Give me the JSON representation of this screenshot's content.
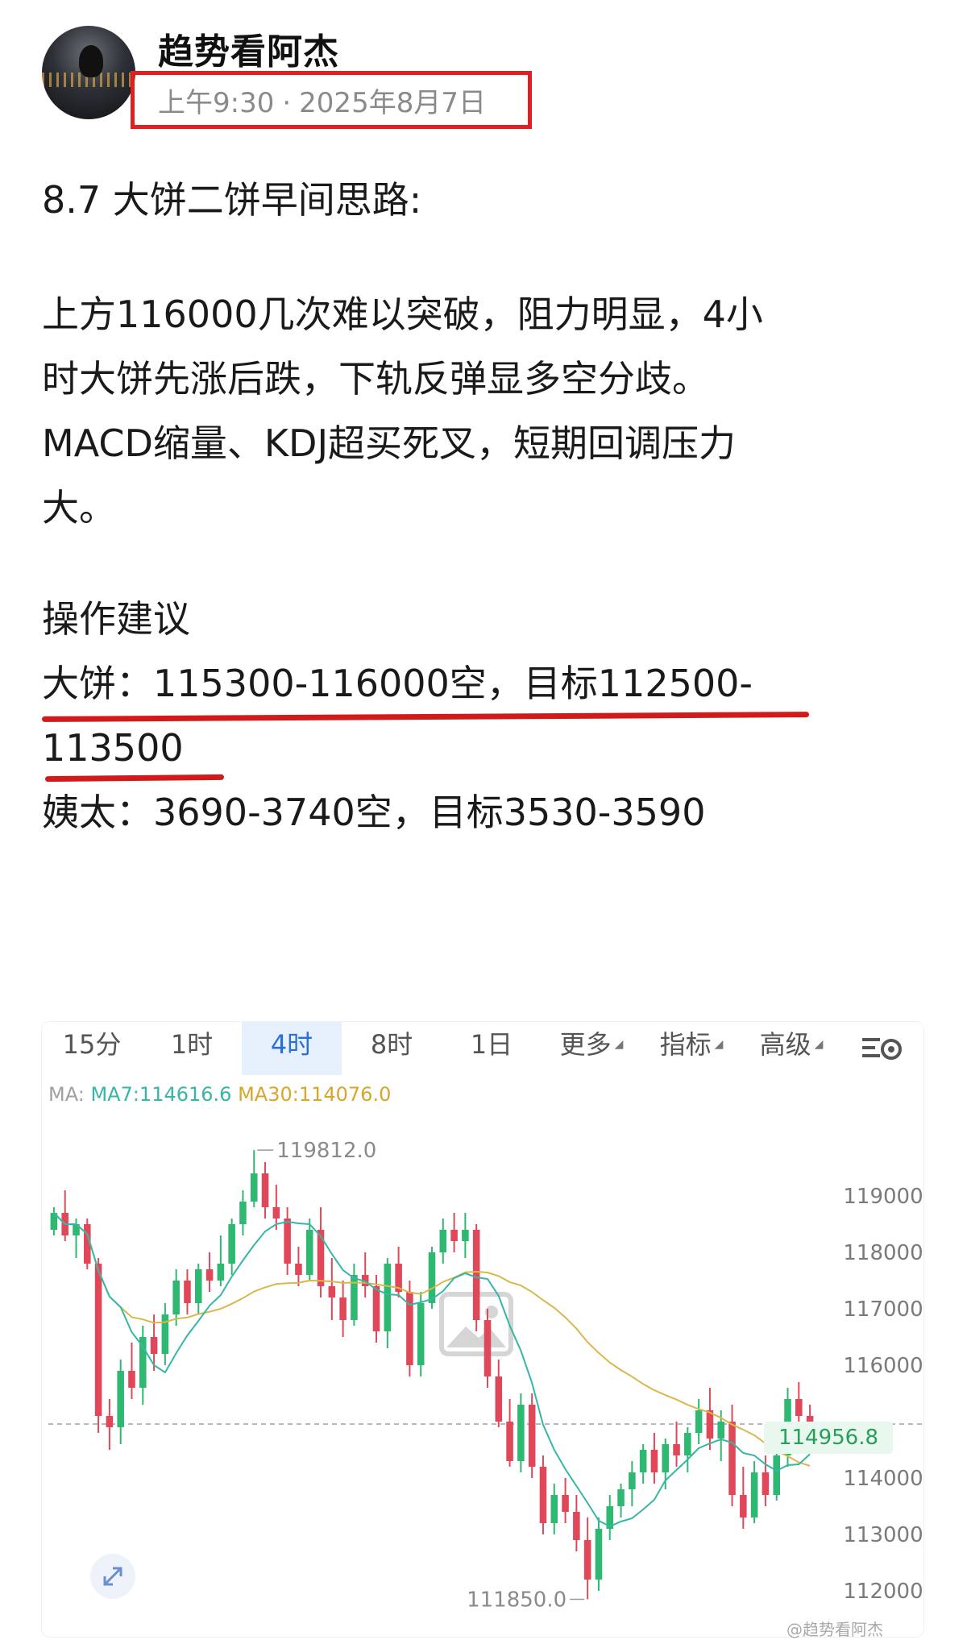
{
  "post": {
    "author": "趋势看阿杰",
    "time": "上午9:30",
    "date": "2025年8月7日",
    "separator": "·",
    "title": "8.7 大饼二饼早间思路:",
    "body_lines": [
      "上方116000几次难以突破，阻力明显，4小",
      "时大饼先涨后跌，下轨反弹显多空分歧。",
      "MACD缩量、KDJ超买死叉，短期回调压力",
      "大。"
    ],
    "ops_heading": "操作建议",
    "ops_lines": [
      "大饼：115300-116000空，目标112500-",
      "113500",
      "姨太：3690-3740空，目标3530-3590"
    ],
    "watermark": "@趋势看阿杰"
  },
  "chart": {
    "tabs": [
      {
        "label": "15分",
        "active": false
      },
      {
        "label": "1时",
        "active": false
      },
      {
        "label": "4时",
        "active": true
      },
      {
        "label": "8时",
        "active": false
      },
      {
        "label": "1日",
        "active": false
      },
      {
        "label": "更多",
        "active": false
      },
      {
        "label": "指标",
        "active": false
      },
      {
        "label": "高级",
        "active": false
      }
    ],
    "settings_icon": "list-gear-icon",
    "ma_label": "MA:",
    "ma7_label": "MA7:114616.6",
    "ma30_label": "MA30:114076.0",
    "current_price": "114956.8",
    "high_label": "119812.0",
    "low_label": "111850.0",
    "expand_icon": "expand-arrows-icon",
    "placeholder_icon": "image-placeholder-icon",
    "colors": {
      "up": "#2eb872",
      "down": "#e0485a",
      "ma7": "#36b6a6",
      "ma30": "#d9b84a",
      "active_tab": "#2a6fd8"
    }
  },
  "chart_data": {
    "type": "candlestick",
    "title": "",
    "timeframe": "4时",
    "ylim": [
      112000,
      119000
    ],
    "yticks": [
      119000,
      118000,
      117000,
      116000,
      114000,
      113000,
      112000
    ],
    "current_price": 114956.8,
    "high": 119812.0,
    "low": 111850.0,
    "ohlc": [
      [
        118400,
        118800,
        118300,
        118700
      ],
      [
        118700,
        119100,
        118200,
        118300
      ],
      [
        118300,
        118600,
        117900,
        118500
      ],
      [
        118500,
        118600,
        117700,
        117800
      ],
      [
        117800,
        117900,
        114800,
        115100
      ],
      [
        115100,
        115400,
        114500,
        114900
      ],
      [
        114900,
        116100,
        114600,
        115900
      ],
      [
        115900,
        116400,
        115400,
        115600
      ],
      [
        115600,
        116700,
        115300,
        116500
      ],
      [
        116500,
        116900,
        115900,
        116200
      ],
      [
        116200,
        117100,
        116000,
        116900
      ],
      [
        116900,
        117700,
        116700,
        117500
      ],
      [
        117500,
        117700,
        116900,
        117100
      ],
      [
        117100,
        117800,
        116900,
        117700
      ],
      [
        117700,
        118000,
        117300,
        117500
      ],
      [
        117500,
        118300,
        117400,
        117800
      ],
      [
        117800,
        118600,
        117600,
        118500
      ],
      [
        118500,
        119100,
        118300,
        118900
      ],
      [
        118900,
        119812,
        118800,
        119400
      ],
      [
        119400,
        119600,
        118600,
        118800
      ],
      [
        118800,
        119200,
        118400,
        118600
      ],
      [
        118600,
        118800,
        117600,
        117800
      ],
      [
        117800,
        118100,
        117400,
        117600
      ],
      [
        117600,
        118600,
        117500,
        118400
      ],
      [
        118400,
        118800,
        117200,
        117400
      ],
      [
        117400,
        117900,
        116800,
        117200
      ],
      [
        117200,
        117500,
        116500,
        116800
      ],
      [
        116800,
        117800,
        116700,
        117600
      ],
      [
        117600,
        118000,
        117200,
        117400
      ],
      [
        117400,
        117600,
        116400,
        116600
      ],
      [
        116600,
        117900,
        116300,
        117800
      ],
      [
        117800,
        118100,
        117200,
        117300
      ],
      [
        117300,
        117500,
        115800,
        116000
      ],
      [
        116000,
        117300,
        115800,
        117100
      ],
      [
        117100,
        118100,
        117000,
        118000
      ],
      [
        118000,
        118600,
        117800,
        118400
      ],
      [
        118400,
        118700,
        118000,
        118200
      ],
      [
        118200,
        118700,
        117900,
        118400
      ],
      [
        118400,
        118500,
        116600,
        116800
      ],
      [
        116800,
        117000,
        115600,
        115800
      ],
      [
        115800,
        116100,
        114900,
        115000
      ],
      [
        115000,
        115400,
        114200,
        114300
      ],
      [
        114300,
        115500,
        114100,
        115300
      ],
      [
        115300,
        115500,
        114000,
        114200
      ],
      [
        114200,
        114400,
        113000,
        113200
      ],
      [
        113200,
        113900,
        113000,
        113700
      ],
      [
        113700,
        114000,
        113200,
        113400
      ],
      [
        113400,
        113700,
        112700,
        112900
      ],
      [
        112900,
        113300,
        111850,
        112200
      ],
      [
        112200,
        113300,
        112000,
        113100
      ],
      [
        113100,
        113700,
        112900,
        113500
      ],
      [
        113500,
        113900,
        113300,
        113800
      ],
      [
        113800,
        114300,
        113500,
        114100
      ],
      [
        114100,
        114600,
        113900,
        114500
      ],
      [
        114500,
        114800,
        113900,
        114100
      ],
      [
        114100,
        114700,
        113800,
        114600
      ],
      [
        114600,
        115000,
        114200,
        114400
      ],
      [
        114400,
        114900,
        114100,
        114800
      ],
      [
        114800,
        115400,
        114600,
        115200
      ],
      [
        115200,
        115600,
        114500,
        114700
      ],
      [
        114700,
        115200,
        114300,
        115000
      ],
      [
        115000,
        115300,
        113500,
        113700
      ],
      [
        113700,
        114200,
        113100,
        113300
      ],
      [
        113300,
        114300,
        113200,
        114100
      ],
      [
        114100,
        114400,
        113500,
        113700
      ],
      [
        113700,
        114500,
        113600,
        114400
      ],
      [
        114400,
        115600,
        114200,
        115400
      ],
      [
        115400,
        115700,
        114900,
        115100
      ],
      [
        115100,
        115300,
        114800,
        114956.8
      ]
    ],
    "ma7_latest": 114616.6,
    "ma30_latest": 114076.0
  }
}
